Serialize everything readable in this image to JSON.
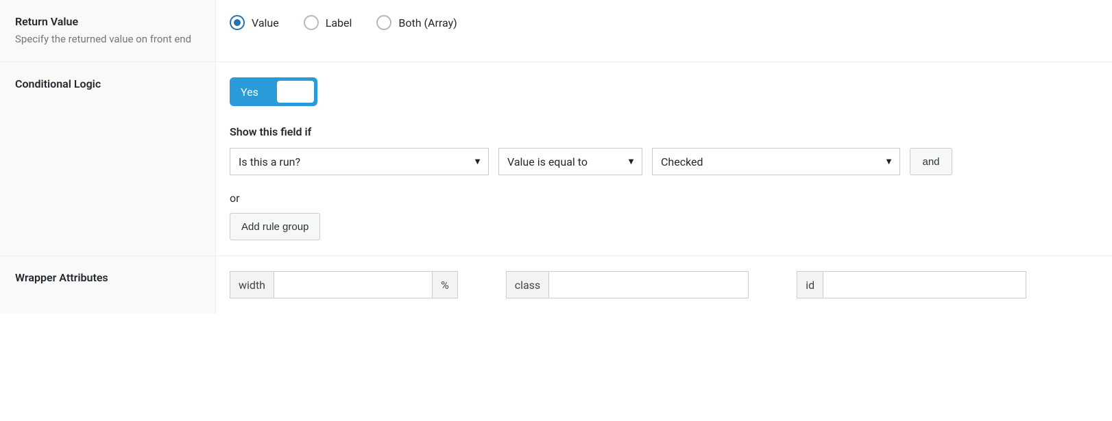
{
  "return_value": {
    "title": "Return Value",
    "description": "Specify the returned value on front end",
    "options": {
      "value": "Value",
      "label": "Label",
      "both": "Both (Array)"
    },
    "selected": "value"
  },
  "conditional_logic": {
    "title": "Conditional Logic",
    "toggle_label": "Yes",
    "toggle_value": true,
    "show_if_heading": "Show this field if",
    "rule": {
      "field": "Is this a run?",
      "operator": "Value is equal to",
      "value": "Checked"
    },
    "and_button": "and",
    "or_label": "or",
    "add_group_button": "Add rule group"
  },
  "wrapper": {
    "title": "Wrapper Attributes",
    "width_label": "width",
    "width_value": "",
    "width_suffix": "%",
    "class_label": "class",
    "class_value": "",
    "id_label": "id",
    "id_value": ""
  }
}
